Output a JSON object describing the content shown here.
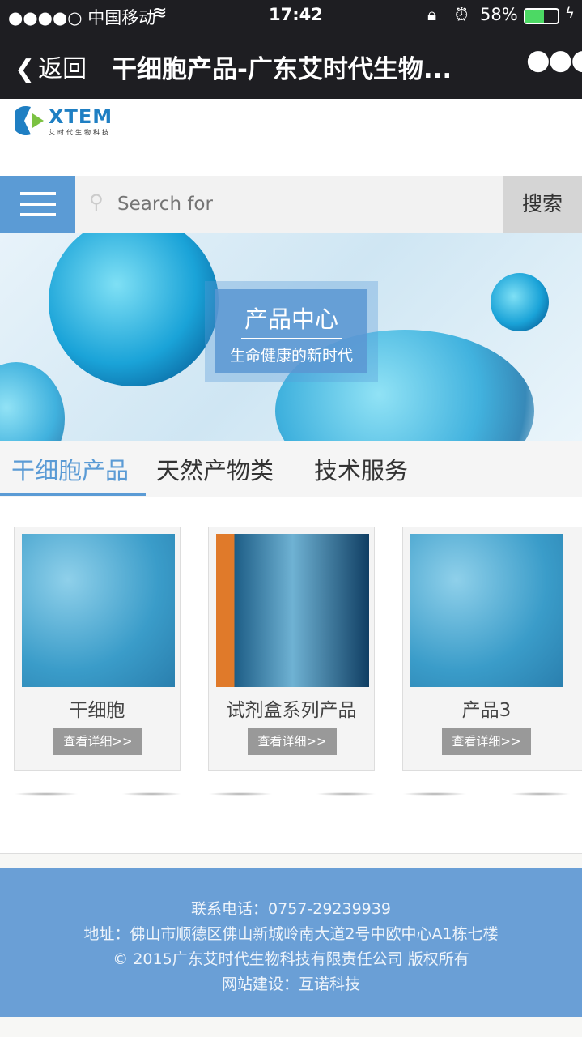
{
  "status_bar": {
    "carrier": "●●●●○ 中国移动",
    "time": "17:42",
    "battery": "58%",
    "battery_level": 0.58
  },
  "nav": {
    "back_label": "返回",
    "title": "干细胞产品-广东艾时代生物...",
    "more_icon": "ellipsis-icon"
  },
  "logo": {
    "text": "XTEM",
    "subtitle": "艾时代生物科技"
  },
  "search": {
    "placeholder": "Search for",
    "button_label": "搜索"
  },
  "banner": {
    "title": "产品中心",
    "subtitle": "生命健康的新时代"
  },
  "tabs": [
    {
      "label": "干细胞产品",
      "active": true
    },
    {
      "label": "天然产物类"
    },
    {
      "label": "技术服务"
    }
  ],
  "products": [
    {
      "title": "干细胞",
      "button": "查看详细>>"
    },
    {
      "title": "试剂盒系列产品",
      "button": "查看详细>>"
    },
    {
      "title": "产品3",
      "button": "查看详细>>"
    }
  ],
  "footer": {
    "phone": "联系电话：0757-29239939",
    "address": "地址：佛山市顺德区佛山新城岭南大道2号中欧中心A1栋七楼",
    "copyright": "© 2015广东艾时代生物科技有限责任公司 版权所有",
    "builder": "网站建设：互诺科技"
  },
  "colors": {
    "accent": "#5b9bd5",
    "footer": "#6a9fd6",
    "nav": "#1e1e22"
  }
}
